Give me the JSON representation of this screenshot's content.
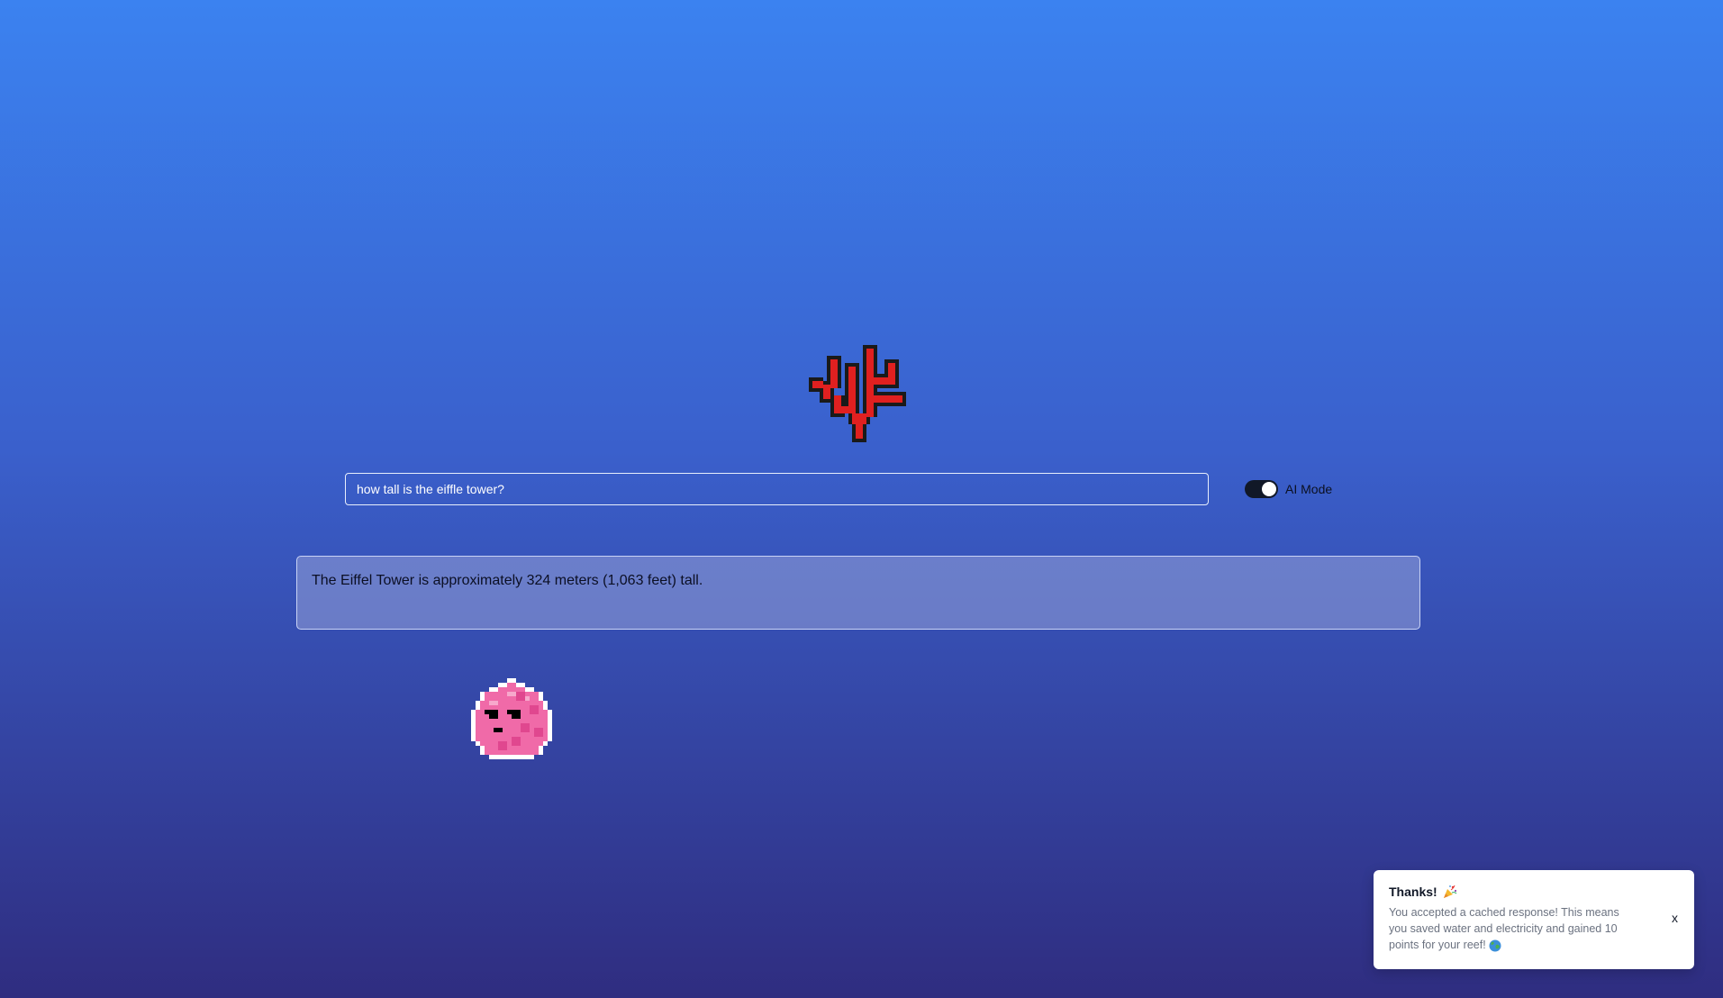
{
  "search": {
    "value": "how tall is the eiffle tower?",
    "placeholder": ""
  },
  "ai_mode": {
    "label": "AI Mode",
    "enabled": true
  },
  "answer": {
    "text": "The Eiffel Tower is approximately 324 meters (1,063 feet) tall."
  },
  "toast": {
    "title": "Thanks!",
    "title_icon": "party-popper-icon",
    "message": "You accepted a cached response! This means you saved water and electricity and gained 10 points for your reef!",
    "message_icon": "globe-icon",
    "close_label": "x"
  },
  "colors": {
    "background_top": "#3b82f0",
    "background_bottom": "#2f2d80",
    "coral": "#e02020",
    "fish": "#f06aa8",
    "toggle_track": "#111827"
  },
  "icons": {
    "coral": "coral-icon",
    "fish": "pink-fish-icon"
  }
}
